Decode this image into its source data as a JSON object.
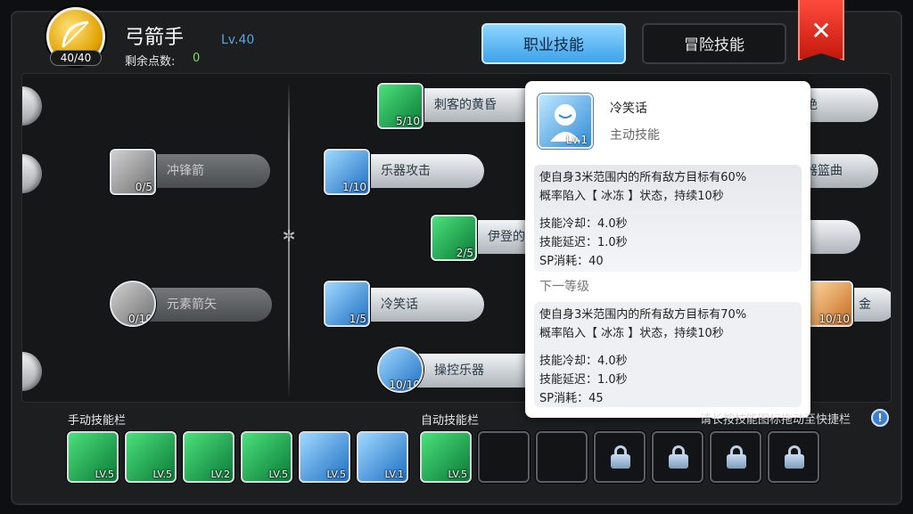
{
  "header": {
    "class_name": "弓箭手",
    "class_level": "Lv.40",
    "class_points": "40/40",
    "remaining_label": "剩余点数:",
    "remaining_value": "0"
  },
  "tabs": [
    {
      "label": "职业技能",
      "active": true
    },
    {
      "label": "冒险技能",
      "active": false
    }
  ],
  "close_label": "✕",
  "tree": {
    "nodes": [
      {
        "name": "刺客的黄昏",
        "count": "5/10",
        "icon": "assassin-dusk-icon"
      },
      {
        "name": "冲锋箭",
        "count": "0/5",
        "icon": "charge-arrow-icon"
      },
      {
        "name": "乐器攻击",
        "count": "1/10",
        "icon": "instrument-attack-icon"
      },
      {
        "name": "伊登的",
        "count": "2/5",
        "icon": "eden-icon"
      },
      {
        "name": "元素箭矢",
        "count": "0/10",
        "icon": "elemental-arrow-icon"
      },
      {
        "name": "冷笑话",
        "count": "1/5",
        "icon": "cold-joke-icon"
      },
      {
        "name": "操控乐器",
        "count": "10/10",
        "icon": "control-instrument-icon"
      },
      {
        "name": "绝",
        "count": "",
        "icon": ""
      },
      {
        "name": "器篮曲",
        "count": "",
        "icon": ""
      },
      {
        "name": "金",
        "count": "10/10",
        "icon": "gold-icon"
      }
    ]
  },
  "tooltip": {
    "skill_name": "冷笑话",
    "skill_level": "Lv.1",
    "skill_type": "主动技能",
    "current_desc_1": "使自身3米范围内的所有敌方目标有60%",
    "current_desc_2": "概率陷入【 冰冻 】状态，持续10秒",
    "cooldown": "技能冷却：4.0秒",
    "delay": "技能延迟：1.0秒",
    "sp": "SP消耗：40",
    "next_label": "下一等级",
    "next_desc_1": "使自身3米范围内的所有敌方目标有70%",
    "next_desc_2": "概率陷入【 冰冻 】状态，持续10秒",
    "next_cooldown": "技能冷却：4.0秒",
    "next_delay": "技能延迟：1.0秒",
    "next_sp": "SP消耗：45"
  },
  "bottom": {
    "manual_label": "手动技能栏",
    "auto_label": "自动技能栏",
    "hint": "请长按技能图标拖动至快捷栏",
    "info_icon": "!",
    "manual_slots": [
      {
        "level": "LV.5",
        "icon": "assassin-dusk-icon"
      },
      {
        "level": "LV.5",
        "icon": "green-orb-icon"
      },
      {
        "level": "LV.2",
        "icon": "eden-icon"
      },
      {
        "level": "LV.5",
        "icon": "treble-clef-icon"
      },
      {
        "level": "LV.5",
        "icon": "dancer-icon"
      },
      {
        "level": "LV.1",
        "icon": "cold-joke-icon"
      }
    ],
    "auto_slots": [
      {
        "level": "LV.5",
        "icon": "treble-clef-icon"
      }
    ]
  },
  "colors": {
    "accent_blue": "#3ea3ea",
    "close_red": "#e0251a",
    "green_points": "#7be05a"
  }
}
